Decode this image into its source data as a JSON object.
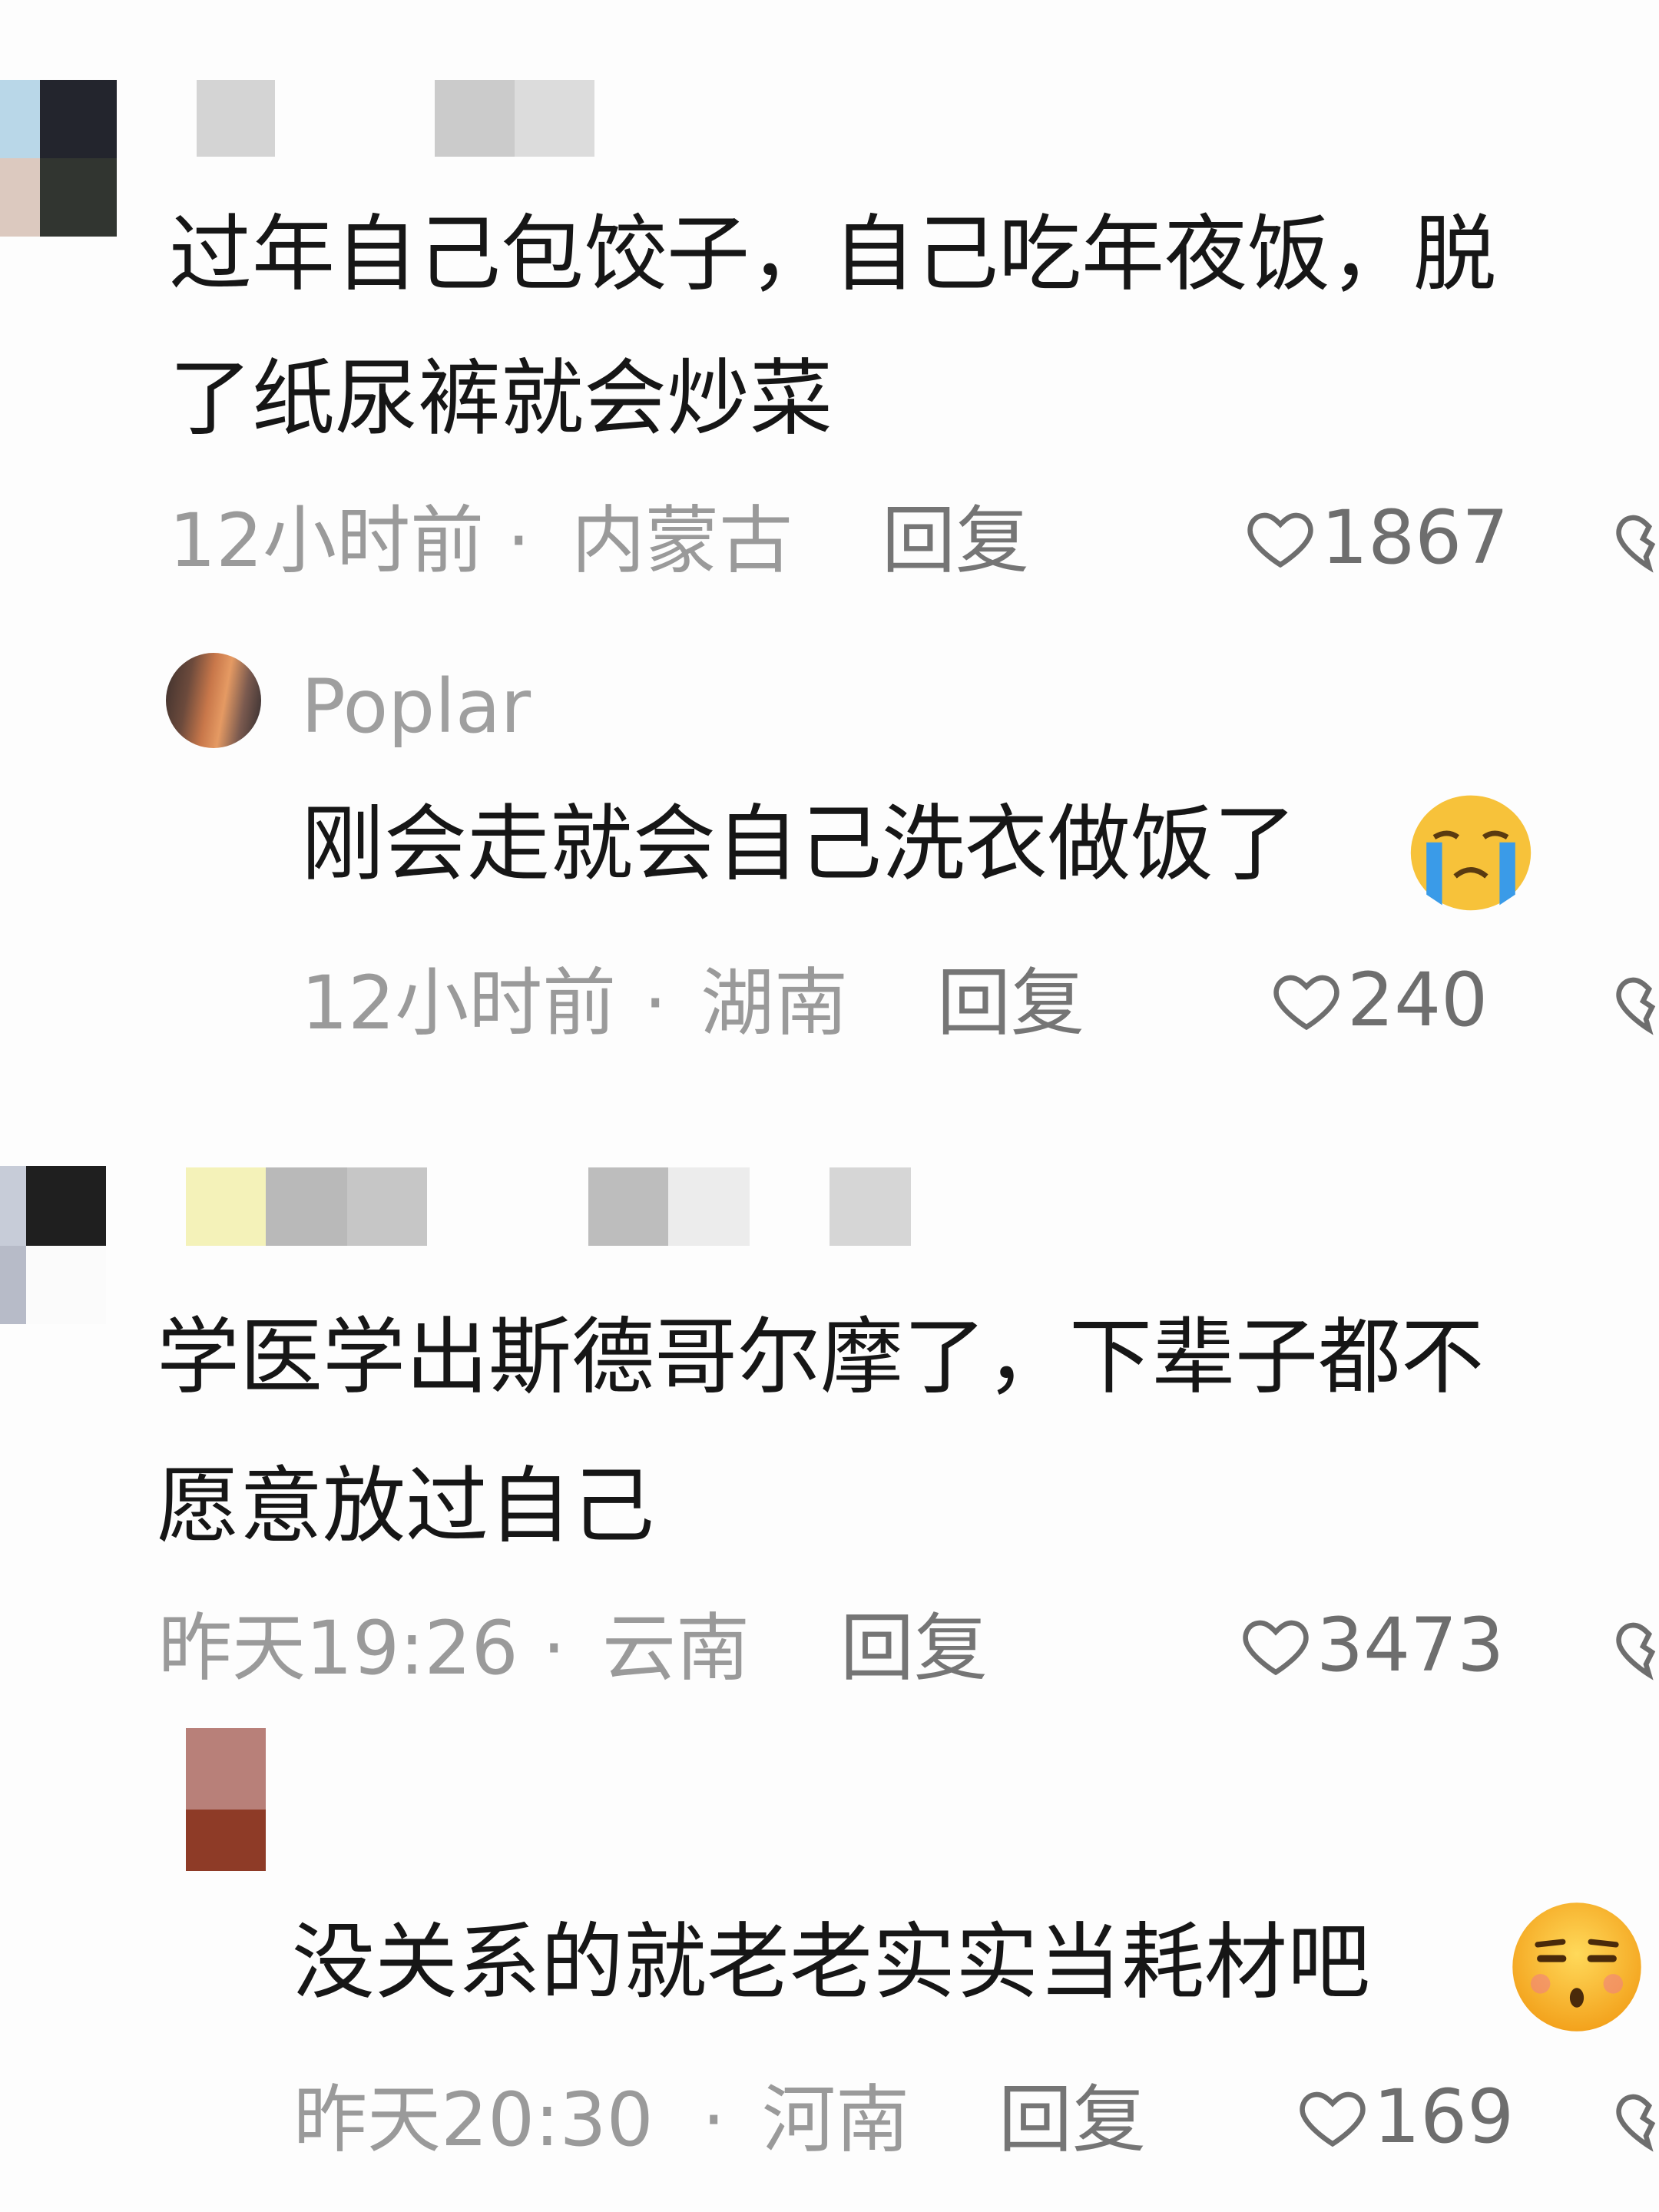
{
  "comments": [
    {
      "text_lines": [
        "过年自己包饺子，自己吃年夜饭，脱",
        "了纸尿裤就会炒菜"
      ],
      "time": "12小时前",
      "sep": "·",
      "location": "内蒙古",
      "reply_label": "回复",
      "likes": "1867",
      "reply": {
        "username": "Poplar",
        "text": "刚会走就会自己洗衣做饭了",
        "emoji": "crying-face",
        "time": "12小时前",
        "sep": "·",
        "location": "湖南",
        "reply_label": "回复",
        "likes": "240"
      }
    },
    {
      "text_lines": [
        "学医学出斯德哥尔摩了，下辈子都不",
        "愿意放过自己"
      ],
      "time": "昨天19:26",
      "sep": "·",
      "location": "云南",
      "reply_label": "回复",
      "likes": "3473",
      "reply": {
        "text": "没关系的就老老实实当耗材吧",
        "emoji": "unamused-face",
        "time": "昨天20:30",
        "sep": "·",
        "location": "河南",
        "reply_label": "回复",
        "likes": "169"
      }
    }
  ],
  "colors": {
    "text": "#161616",
    "meta": "#9a9a9a",
    "reply": "#757575",
    "like": "#6e6e6e",
    "background": "#fdfdfd"
  }
}
